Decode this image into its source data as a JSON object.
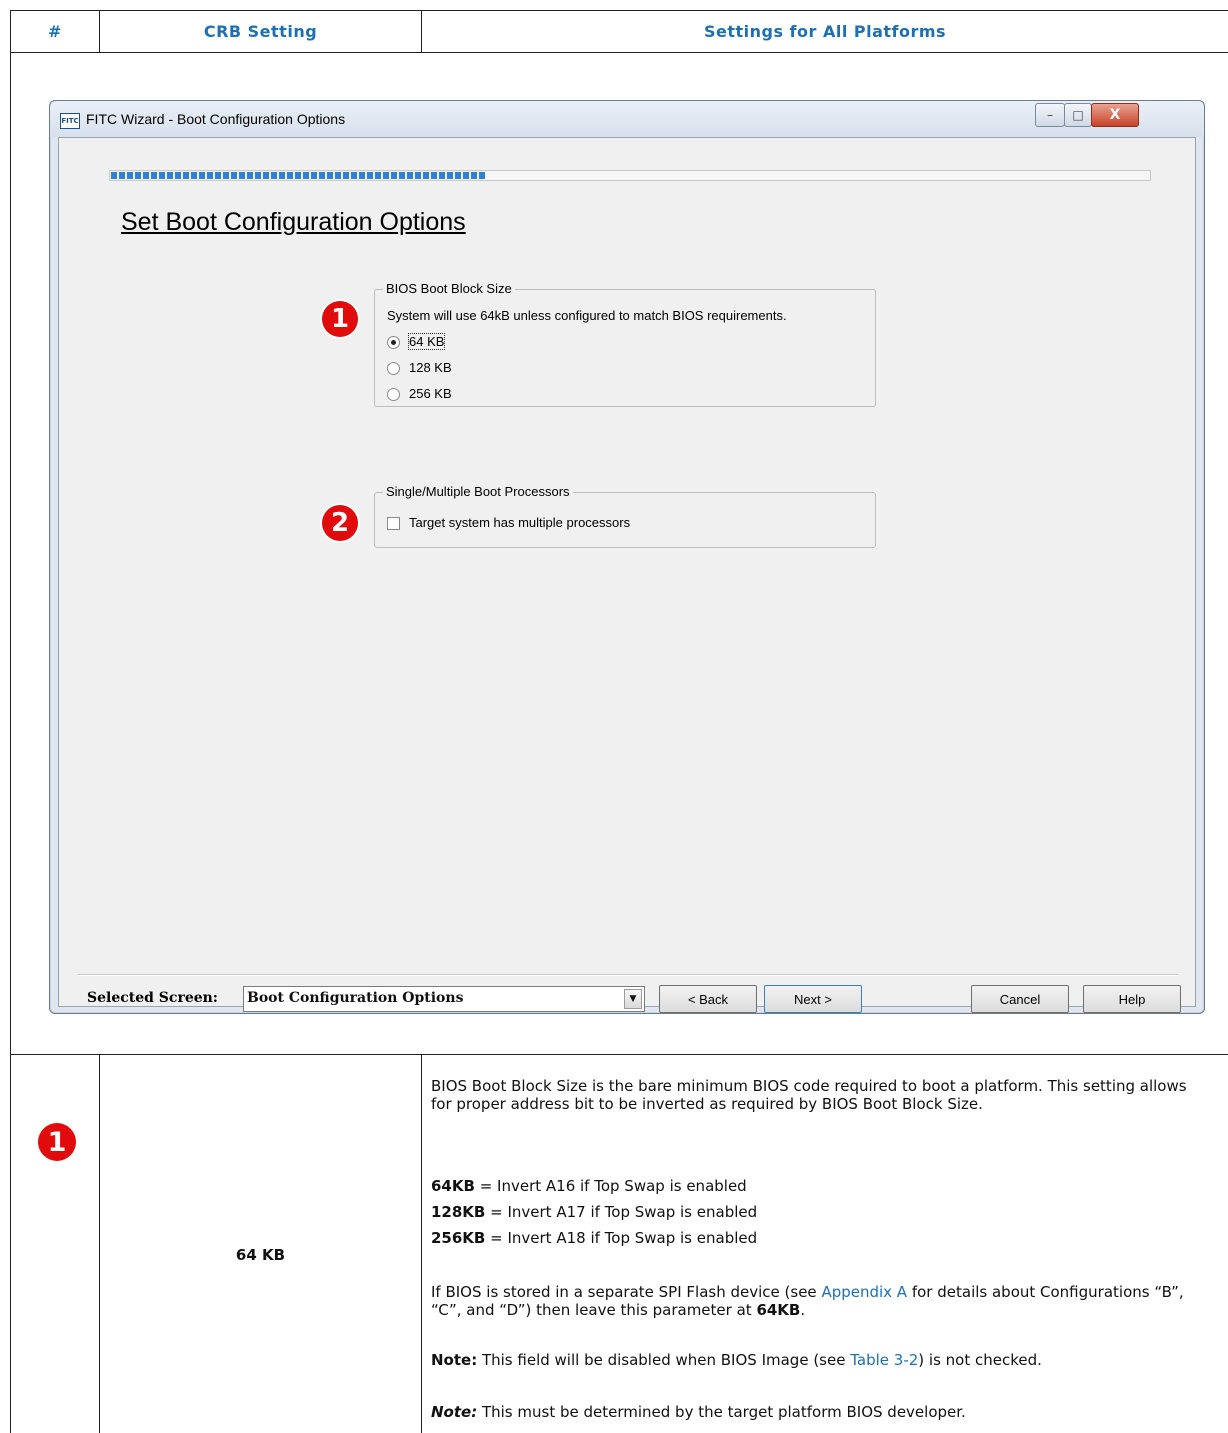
{
  "table": {
    "headers": [
      "#",
      "CRB Setting",
      "Settings for All Platforms"
    ]
  },
  "dialog": {
    "title": "FITC Wizard - Boot Configuration Options",
    "app_icon_text": "FITC",
    "window_buttons": {
      "minimize": "–",
      "maximize": "□",
      "close": "X"
    },
    "progress_fraction": 0.36,
    "heading": "Set Boot Configuration Options",
    "group1": {
      "legend": "BIOS Boot Block Size",
      "note": "System will use 64kB unless configured to match BIOS requirements.",
      "options": [
        "64 KB",
        "128 KB",
        "256 KB"
      ],
      "selected": "64 KB"
    },
    "group2": {
      "legend": "Single/Multiple Boot Processors",
      "checkbox_label": "Target system has multiple processors",
      "checked": false
    },
    "selected_screen_label": "Selected Screen:",
    "selected_screen_value": "Boot Configuration Options",
    "buttons": {
      "back": "< Back",
      "next": "Next >",
      "cancel": "Cancel",
      "help": "Help"
    }
  },
  "markers": [
    "1",
    "2"
  ],
  "row1": {
    "marker": "1",
    "setting": "64 KB",
    "description": {
      "intro": "BIOS Boot Block Size is the bare minimum BIOS code required to boot a platform. This setting allows for proper address bit to be inverted as required by BIOS Boot Block Size.",
      "items": [
        {
          "label": "64KB",
          "text": " = Invert A16 if Top Swap is enabled"
        },
        {
          "label": "128KB",
          "text": " = Invert A17 if Top Swap is enabled"
        },
        {
          "label": "256KB",
          "text": " = Invert A18 if Top Swap is enabled"
        }
      ],
      "para2_a": "If BIOS is stored in a separate SPI Flash device (see ",
      "para2_link": "Appendix A",
      "para2_b": " for details about Configurations “B”, “C”, and “D”) then leave this parameter at ",
      "para2_bold": "64KB",
      "para2_c": ".",
      "note1_label": "Note:",
      "note1_a": " This field will be disabled when BIOS Image (see ",
      "note1_link": "Table 3-2",
      "note1_b": ") is not checked.",
      "note2_label": "Note:",
      "note2_text": " This must be determined by the target platform BIOS developer."
    }
  }
}
